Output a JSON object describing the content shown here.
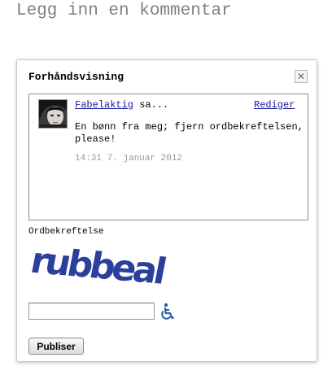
{
  "page": {
    "heading": "Legg inn en kommentar"
  },
  "dialog": {
    "title": "Forhåndsvisning",
    "close_symbol": "✕",
    "close_icon": "close-icon"
  },
  "comment": {
    "author": "Fabelaktig",
    "says": " sa...",
    "edit_label": "Rediger",
    "body": "En bønn fra meg; fjern ordbekreftelsen, please!",
    "timestamp": "14:31 7. januar 2012",
    "avatar_icon": "user-avatar"
  },
  "captcha": {
    "label": "Ordbekreftelse",
    "image_word": "rubbeal",
    "word_color": "#2b3f9c",
    "input_value": "",
    "accessibility_icon": "wheelchair-icon",
    "accessibility_color": "#2b5fa8"
  },
  "actions": {
    "publish_label": "Publiser"
  }
}
